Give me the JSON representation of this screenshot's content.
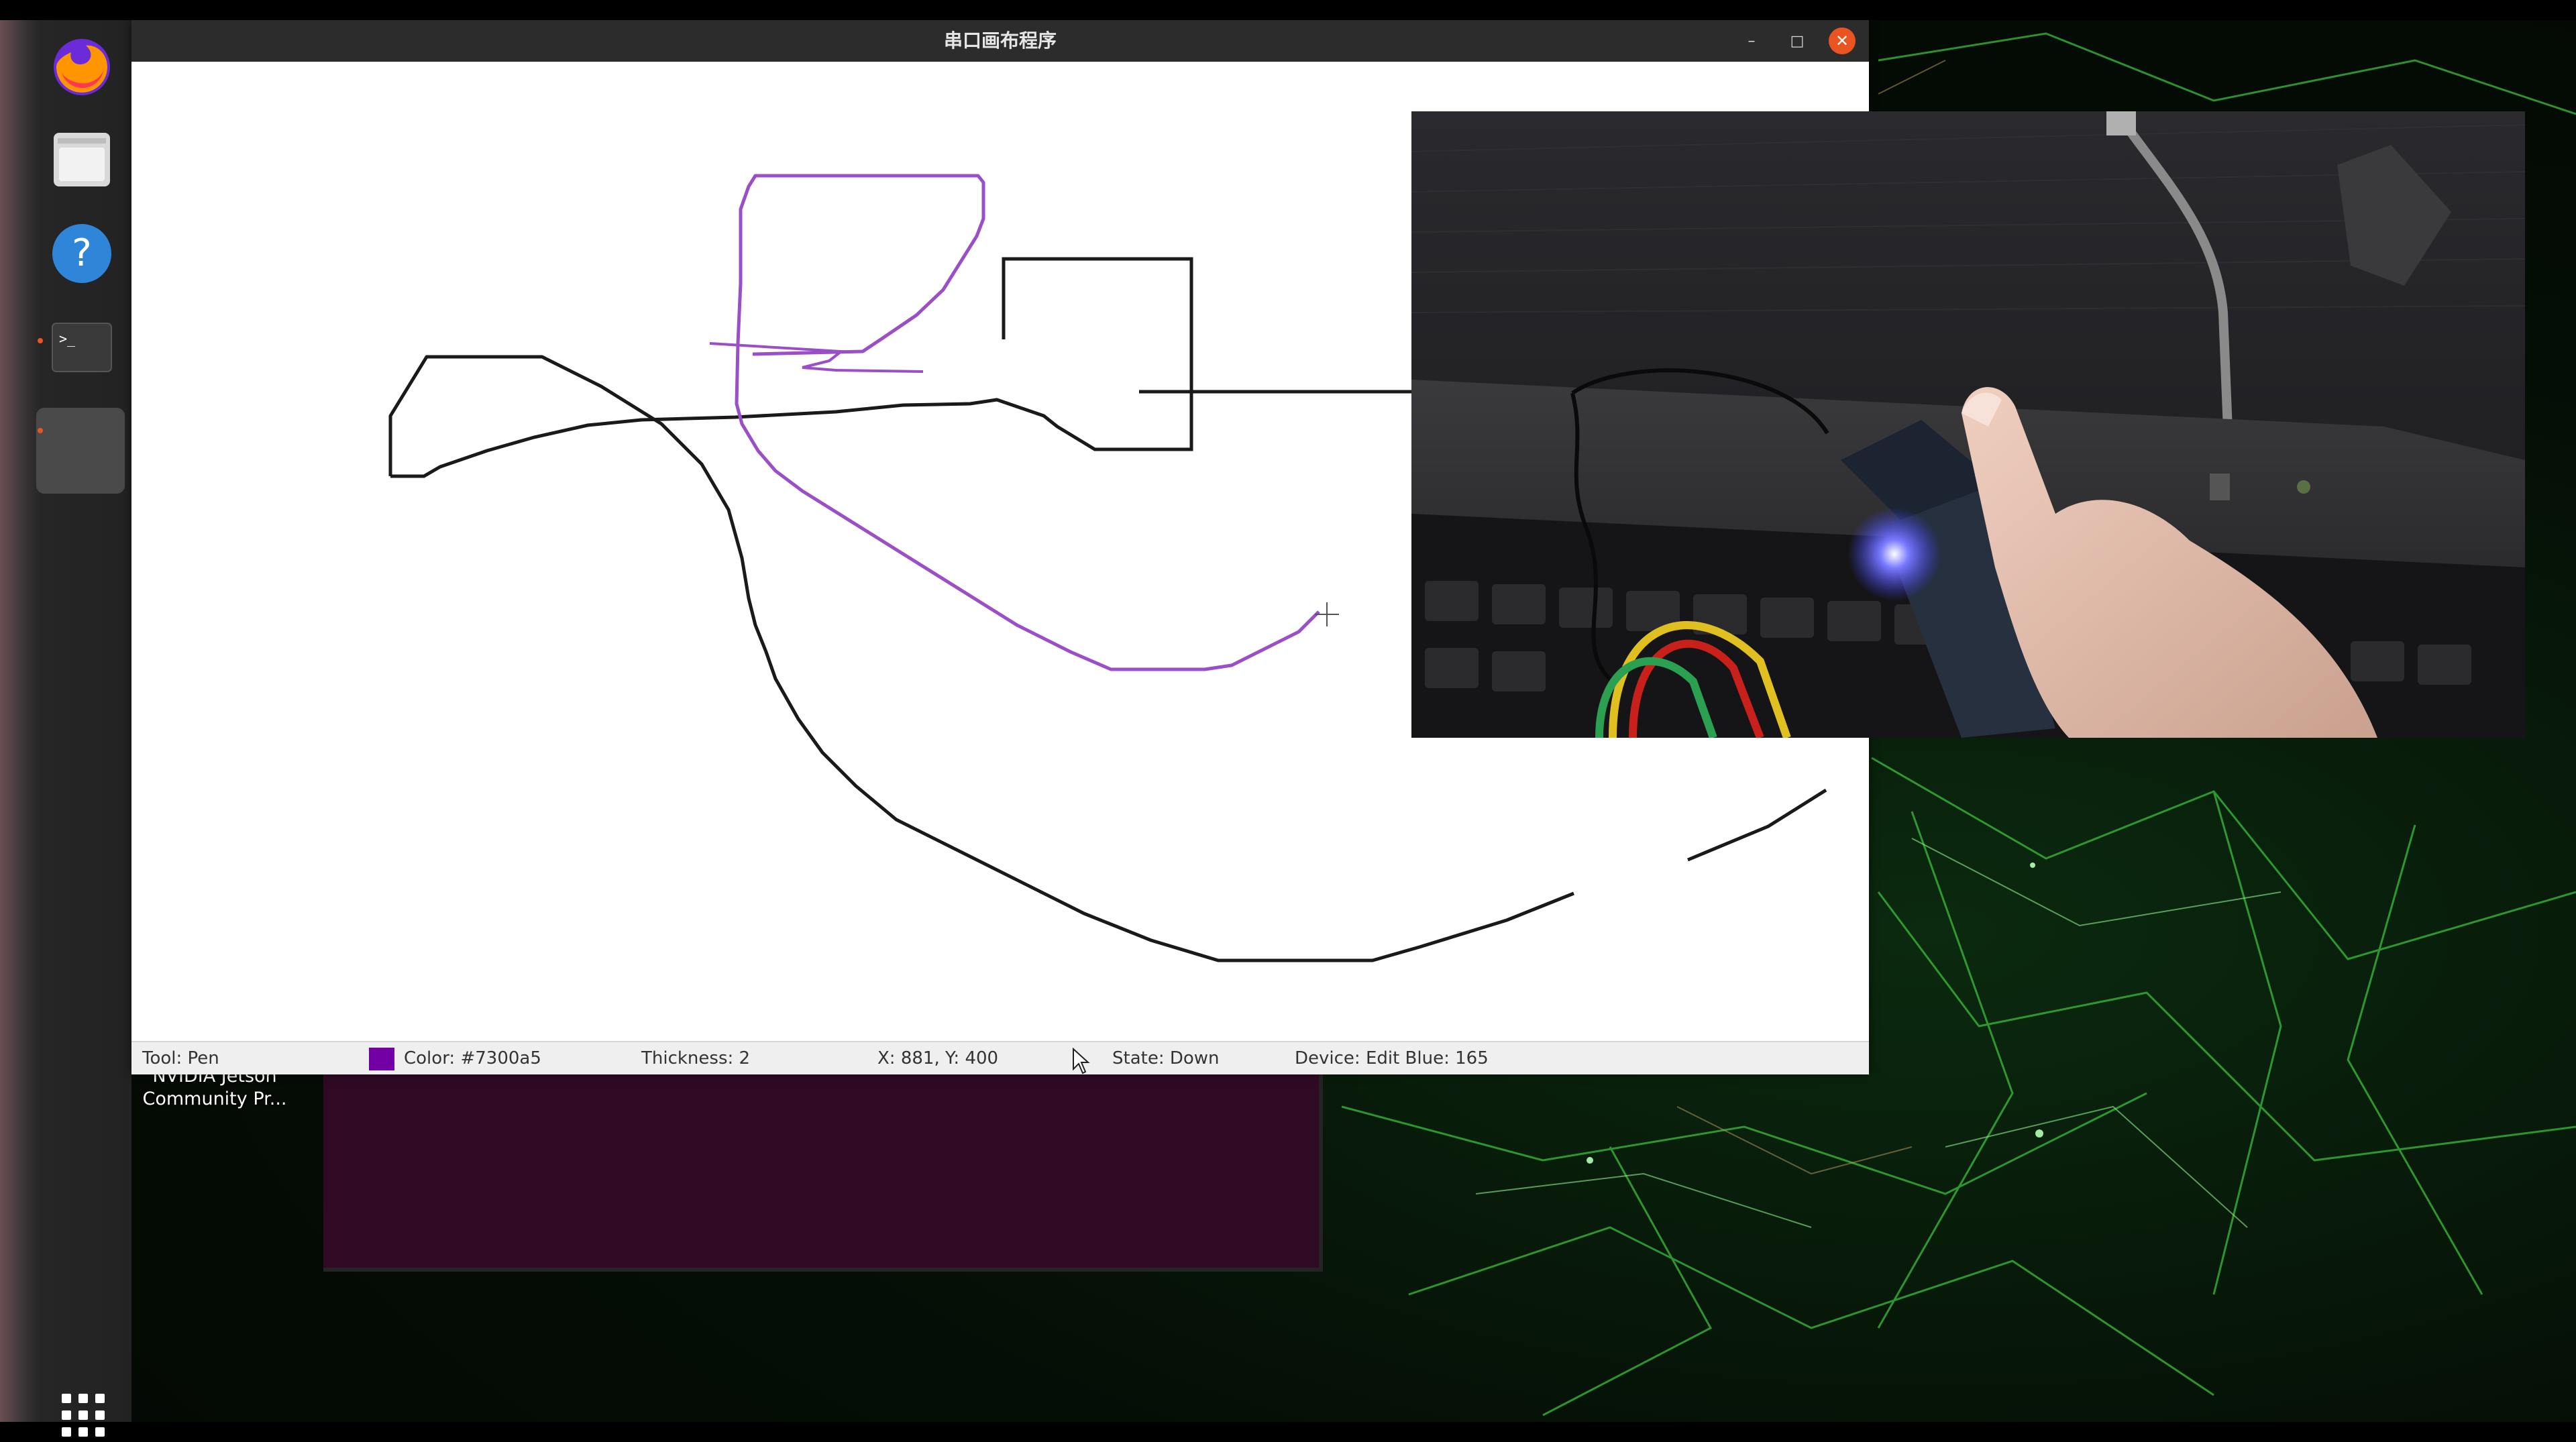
{
  "window": {
    "title": "串口画布程序",
    "minimize_label": "–",
    "maximize_label": "□",
    "close_label": "✕"
  },
  "statusbar": {
    "tool": "Tool: Pen",
    "color_text": "Color: #7300a5",
    "thickness": "Thickness: 2",
    "coords": "X: 881, Y: 400",
    "state": "State: Down",
    "device": "Device: Edit Blue: 165"
  },
  "colors": {
    "pen_color": "#7300a5",
    "close_button": "#e95420",
    "terminal_bg": "#300a24"
  },
  "dock": {
    "items": [
      {
        "name": "firefox-icon"
      },
      {
        "name": "files-icon"
      },
      {
        "name": "help-icon"
      },
      {
        "name": "terminal-icon"
      },
      {
        "name": "active-app-icon"
      },
      {
        "name": "show-apps-icon"
      }
    ]
  },
  "desktop": {
    "icon_label_line1": "NVIDIA Jetson",
    "icon_label_line2": "Community Pr..."
  }
}
